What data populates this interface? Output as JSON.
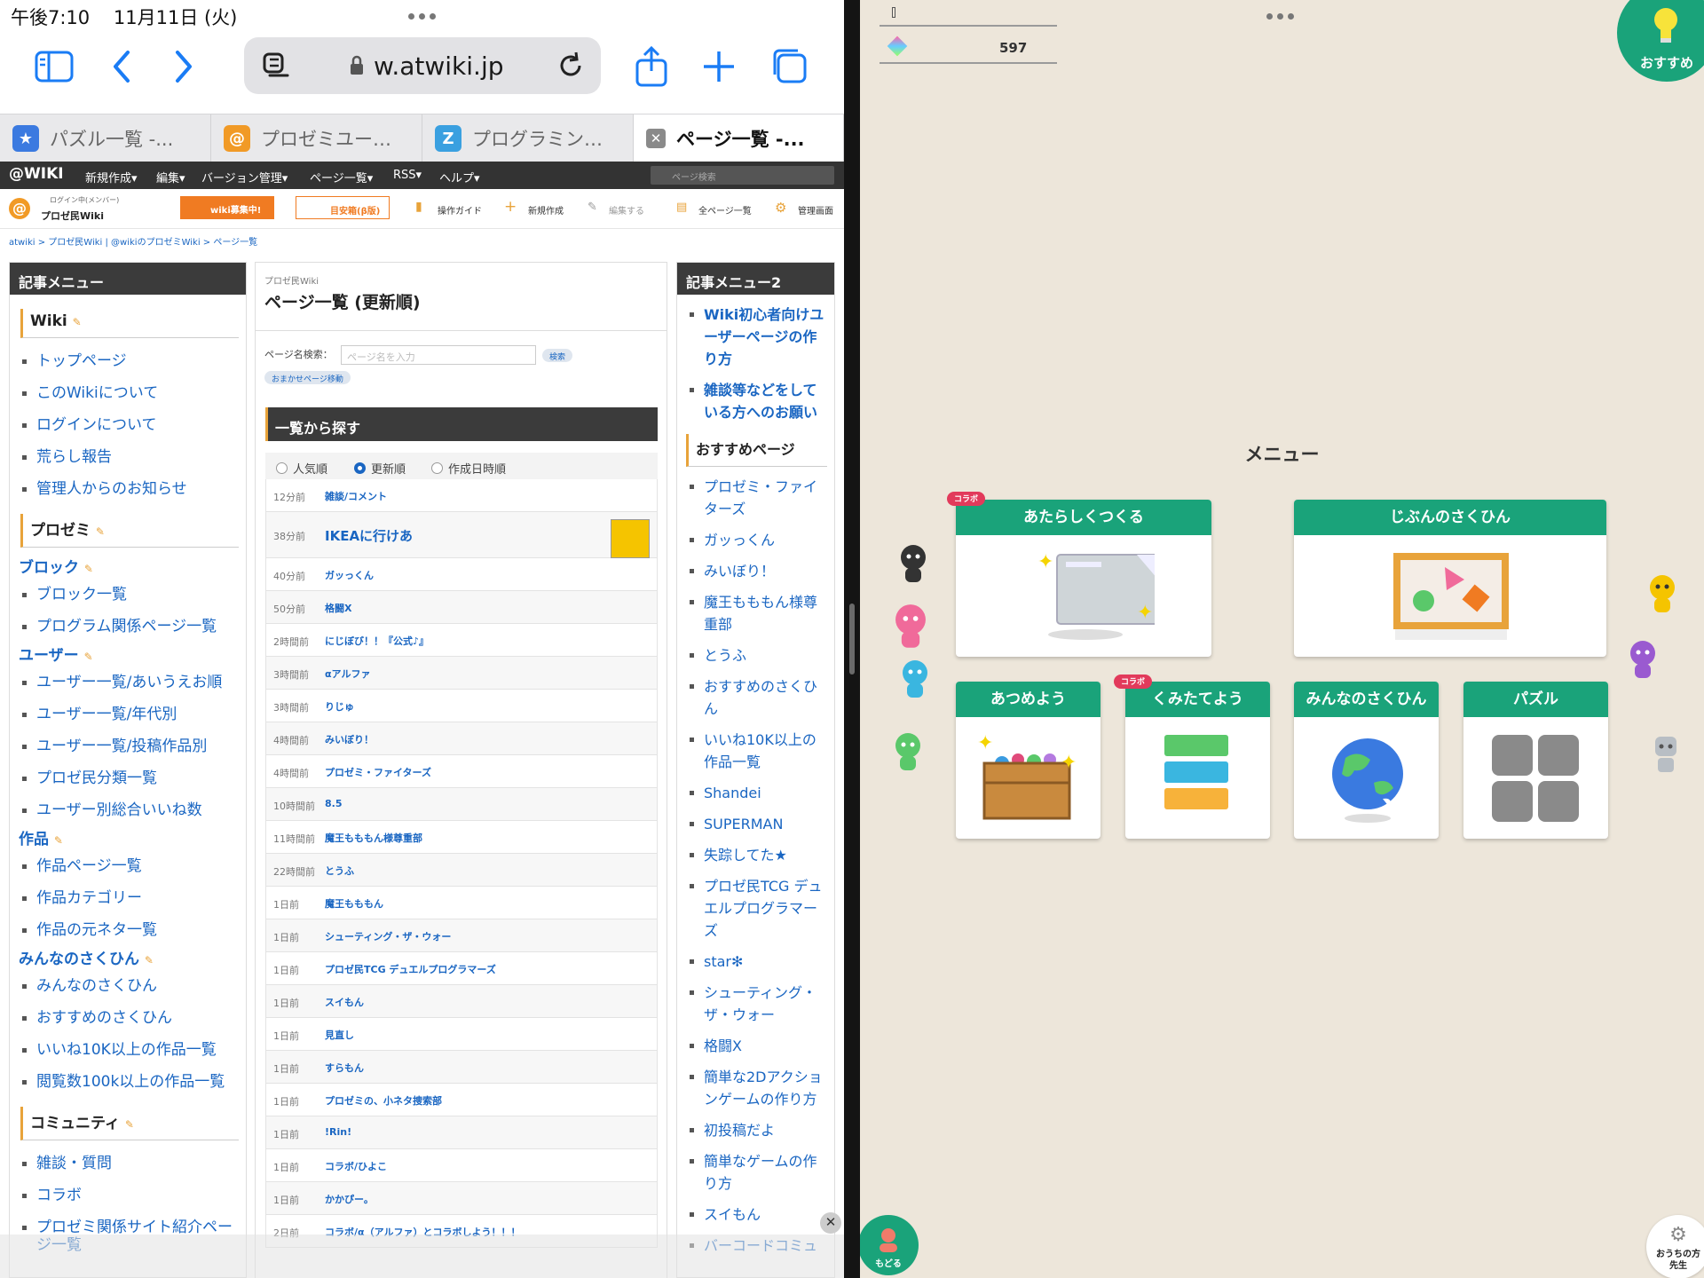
{
  "left": {
    "status": {
      "time": "午後7:10",
      "date": "11月11日 (火)"
    },
    "url": "w.atwiki.jp",
    "tabs": [
      {
        "label": "パズル一覧 -...",
        "icon": "star-icon"
      },
      {
        "label": "プロゼミユー…",
        "icon": "atwiki-icon"
      },
      {
        "label": "プログラミン…",
        "icon": "z-icon"
      },
      {
        "label": "ページ一覧 -...",
        "icon": "close-icon"
      }
    ],
    "wikibar": {
      "brand": "@WIKI",
      "menus": [
        "新規作成▾",
        "編集▾",
        "バージョン管理▾",
        "ページ一覧▾",
        "RSS▾",
        "ヘルプ▾"
      ],
      "search_placeholder": "ページ検索"
    },
    "wikitools": {
      "login": "ログイン中(メンバー)",
      "site": "プロゼ民Wiki",
      "recruit": "wiki募集中!",
      "badge": "目安箱(β版)",
      "guide": "操作ガイド",
      "new": "新規作成",
      "edit": "編集する",
      "allpages": "全ページ一覧",
      "admin": "管理画面"
    },
    "breadcrumb": "atwiki > プロゼ民Wiki | @wikiのプロゼミWiki > ページ一覧",
    "menu1": {
      "title": "記事メニュー",
      "sec_wiki": "Wiki",
      "wiki_items": [
        "トップページ",
        "このWikiについて",
        "ログインについて",
        "荒らし報告",
        "管理人からのお知らせ"
      ],
      "sec_prozemi": "プロゼミ",
      "sub_block": "ブロック",
      "block_items": [
        "ブロック一覧",
        "プログラム関係ページ一覧"
      ],
      "sub_user": "ユーザー",
      "user_items": [
        "ユーザー一覧/あいうえお順",
        "ユーザー一覧/年代別",
        "ユーザー一覧/投稿作品別",
        "プロゼ民分類一覧",
        "ユーザー別総合いいね数"
      ],
      "sub_works": "作品",
      "works_items": [
        "作品ページ一覧",
        "作品カテゴリー",
        "作品の元ネタ一覧"
      ],
      "sub_minna": "みんなのさくひん",
      "minna_items": [
        "みんなのさくひん",
        "おすすめのさくひん",
        "いいね10K以上の作品一覧",
        "閲覧数100k以上の作品一覧"
      ],
      "sec_comm": "コミュニティ",
      "comm_items": [
        "雑談・質問",
        "コラボ",
        "プロゼミ関係サイト紹介ページ一覧"
      ]
    },
    "main": {
      "site": "プロゼ民Wiki",
      "title": "ページ一覧 (更新順)",
      "search_label": "ページ名検索：",
      "search_placeholder": "ページ名を入力",
      "search_btn": "検索",
      "random_btn": "おまかせページ移動",
      "list_head": "一覧から探す",
      "radios": [
        "人気順",
        "更新順",
        "作成日時順"
      ],
      "rows": [
        {
          "time": "12分前",
          "name": "雑談/コメント"
        },
        {
          "time": "38分前",
          "name": "IKEAに行けあ"
        },
        {
          "time": "40分前",
          "name": "ガッっくん"
        },
        {
          "time": "50分前",
          "name": "格闘X"
        },
        {
          "time": "2時間前",
          "name": "にじぼび！！『公式♪』"
        },
        {
          "time": "3時間前",
          "name": "αアルファ"
        },
        {
          "time": "3時間前",
          "name": "りじゅ"
        },
        {
          "time": "4時間前",
          "name": "みいぼり！"
        },
        {
          "time": "4時間前",
          "name": "プロゼミ・ファイターズ"
        },
        {
          "time": "10時間前",
          "name": "8.5"
        },
        {
          "time": "11時間前",
          "name": "魔王もももん様尊重部"
        },
        {
          "time": "22時間前",
          "name": "とうふ"
        },
        {
          "time": "1日前",
          "name": "魔王もももん"
        },
        {
          "time": "1日前",
          "name": "シューティング・ザ・ウォー"
        },
        {
          "time": "1日前",
          "name": "プロゼ民TCG デュエルプログラマーズ"
        },
        {
          "time": "1日前",
          "name": "スイもん"
        },
        {
          "time": "1日前",
          "name": "見直し"
        },
        {
          "time": "1日前",
          "name": "すらもん"
        },
        {
          "time": "1日前",
          "name": "プロゼミの、小ネタ捜索部"
        },
        {
          "time": "1日前",
          "name": "!Rin!"
        },
        {
          "time": "1日前",
          "name": "コラボ/ひよこ"
        },
        {
          "time": "1日前",
          "name": "かかぴー。"
        },
        {
          "time": "2日前",
          "name": "コラボ/α（アルファ）とコラボしよう！！！"
        }
      ]
    },
    "menu2": {
      "title": "記事メニュー2",
      "top_items": [
        "Wiki初心者向けユーザーページの作り方",
        "雑談等などをしている方へのお願い"
      ],
      "sec": "おすすめページ",
      "items": [
        "プロゼミ・ファイターズ",
        "ガッっくん",
        "みいぼり！",
        "魔王もももん様尊重部",
        "とうふ",
        "おすすめのさくひん",
        "いいね10K以上の作品一覧",
        "Shandei",
        "SUPERMAN",
        "失踪してた★",
        "プロゼ民TCG デュエルプログラマーズ",
        "star✻",
        "シューティング・ザ・ウォー",
        "格闘X",
        "簡単な2Dアクションゲームの作り方",
        "初投稿だよ",
        "簡単なゲームの作り方",
        "スイもん",
        "バーコードコミュ"
      ]
    }
  },
  "right": {
    "score": "597",
    "osusume": "おすすめ",
    "menu_title": "メニュー",
    "collab": "コラボ",
    "cards": {
      "new": "あたらしくつくる",
      "mine": "じぶんのさくひん",
      "collect": "あつめよう",
      "build": "くみたてよう",
      "everyone": "みんなのさくひん",
      "puzzle": "パズル"
    },
    "back": "もどる",
    "settings": "おうちの方\n先生"
  },
  "colors": {
    "accent": "#1aa37a",
    "link": "#1a66c2",
    "orange": "#e8a33a",
    "collab": "#e23a5b"
  }
}
